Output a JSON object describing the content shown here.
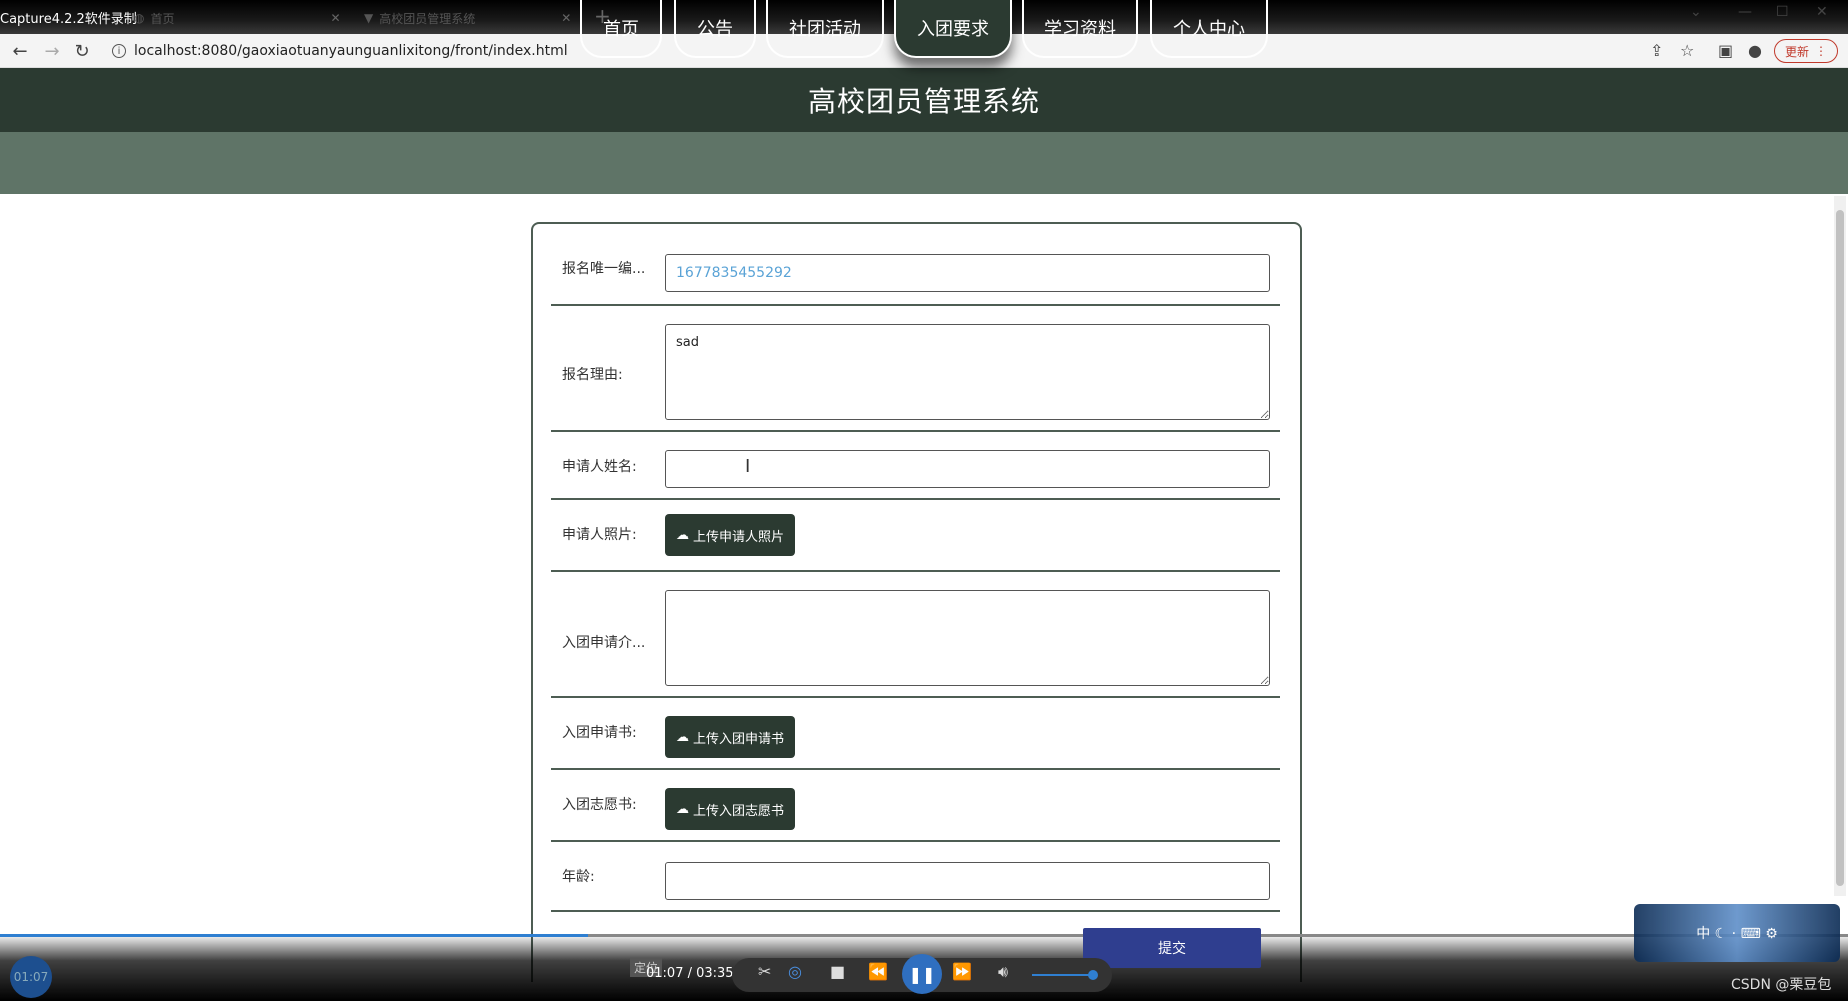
{
  "recorder_title": "Capture4.2.2软件录制",
  "browser": {
    "tabs": [
      {
        "label": "首页"
      },
      {
        "label": "高校团员管理系统"
      }
    ],
    "url": "localhost:8080/gaoxiaotuanyaunguanlixitong/front/index.html",
    "update_label": "更新"
  },
  "site": {
    "title": "高校团员管理系统",
    "nav": [
      "首页",
      "公告",
      "社团活动",
      "入团要求",
      "学习资料",
      "个人中心"
    ],
    "active_nav": "入团要求"
  },
  "form": {
    "fields": {
      "reg_id": {
        "label": "报名唯一编...",
        "value": "1677835455292"
      },
      "reason": {
        "label": "报名理由:",
        "value": "sad"
      },
      "name": {
        "label": "申请人姓名:",
        "value": ""
      },
      "photo": {
        "label": "申请人照片:",
        "button": "上传申请人照片"
      },
      "intro": {
        "label": "入团申请介...",
        "value": ""
      },
      "application": {
        "label": "入团申请书:",
        "button": "上传入团申请书"
      },
      "volunteer": {
        "label": "入团志愿书:",
        "button": "上传入团志愿书"
      },
      "age": {
        "label": "年龄:",
        "value": ""
      }
    },
    "submit_label": "提交"
  },
  "player": {
    "clock": "01:07",
    "locate": "定位",
    "time": "01:07 / 03:35",
    "progress": 0.318
  },
  "watermark": "CSDN @栗豆包",
  "ime_text": "中 ☾ · ⌨ ⚙",
  "colors": {
    "header_bg": "#2b3a31",
    "nav_bg": "#5f7467",
    "submit_bg": "#2f3e8f"
  }
}
